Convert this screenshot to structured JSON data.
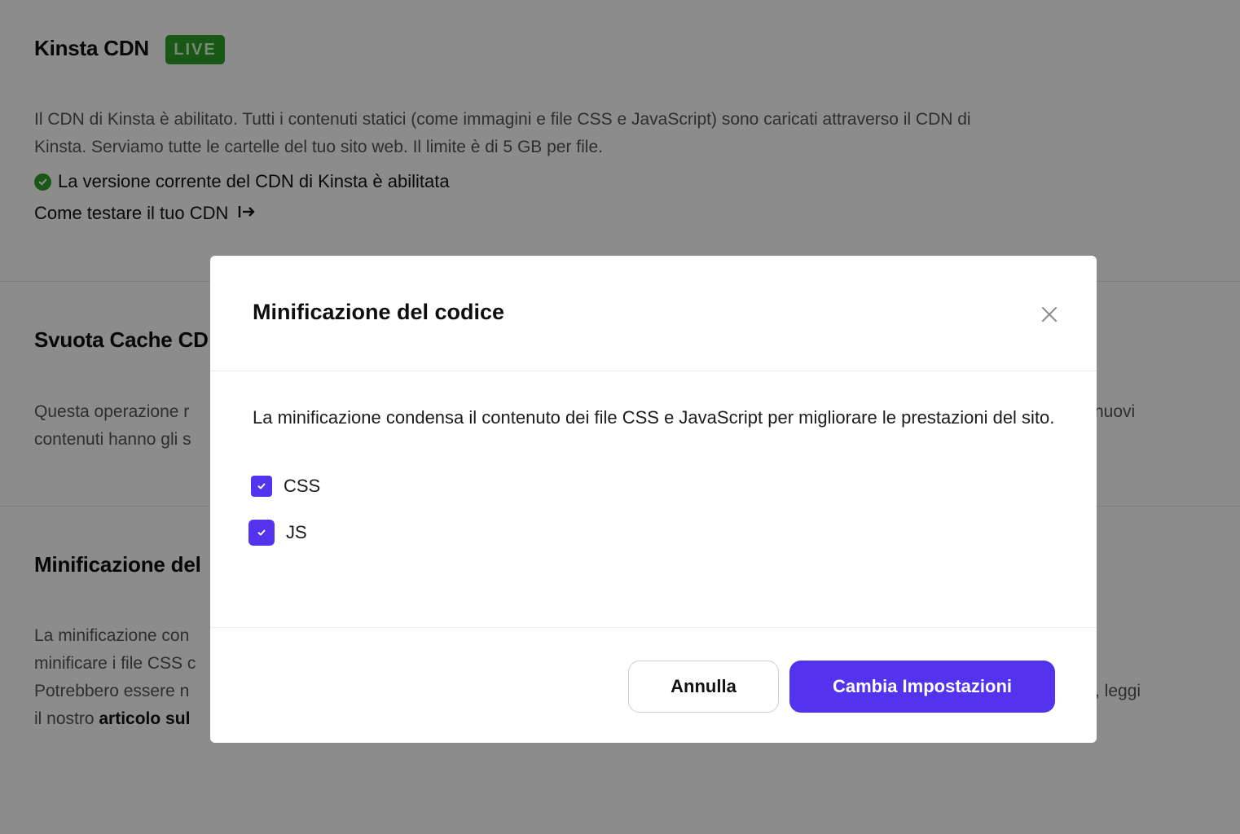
{
  "background": {
    "cdn_section": {
      "title": "Kinsta CDN",
      "badge": "LIVE",
      "description_line1": "Il CDN di Kinsta è abilitato. Tutti i contenuti statici (come immagini e file CSS e JavaScript) sono caricati attraverso il CDN di",
      "description_line2": "Kinsta. Serviamo tutte le cartelle del tuo sito web. Il limite è di 5 GB per file.",
      "status_text": "La versione corrente del CDN di Kinsta è abilitata",
      "link_text": "Come testare il tuo CDN"
    },
    "cache_section": {
      "title": "Svuota Cache CD",
      "line1_left": "Questa operazione r",
      "line1_right": "nuovi",
      "line2_left": "contenuti hanno gli s"
    },
    "minify_section": {
      "title": "Minificazione del",
      "line1": "La minificazione con",
      "line2": "minificare i file CSS c",
      "line3_left": "Potrebbero essere n",
      "line3_right": ", leggi",
      "line4_prefix": "il nostro ",
      "line4_bold": "articolo sul"
    }
  },
  "modal": {
    "title": "Minificazione del codice",
    "description": "La minificazione condensa il contenuto dei file CSS e JavaScript per migliorare le prestazioni del sito.",
    "options": [
      {
        "label": "CSS",
        "checked": true
      },
      {
        "label": "JS",
        "checked": true
      }
    ],
    "cancel_label": "Annulla",
    "confirm_label": "Cambia Impostazioni"
  },
  "colors": {
    "accent": "#5333ed",
    "live_badge": "#2f9e2a",
    "overlay": "rgba(0,0,0,0.45)"
  }
}
